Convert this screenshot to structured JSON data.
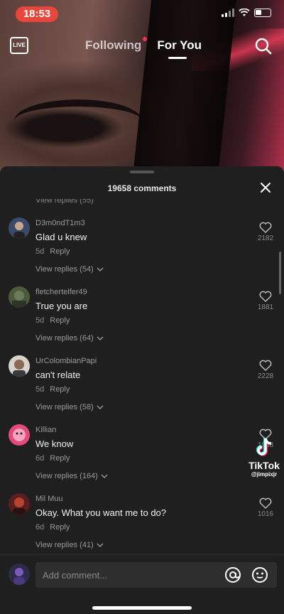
{
  "status_bar": {
    "time": "18:53"
  },
  "nav": {
    "live_label": "LIVE",
    "following_label": "Following",
    "foryou_label": "For You"
  },
  "sheet": {
    "title": "19658 comments",
    "partial_reply": "View replies (55)"
  },
  "comments": [
    {
      "username": "D3m0ndT1m3",
      "text": "Glad u knew",
      "age": "5d",
      "reply_label": "Reply",
      "replies": "View replies (54)",
      "likes": "2182"
    },
    {
      "username": "fletchertelfer49",
      "text": "True you are",
      "age": "5d",
      "reply_label": "Reply",
      "replies": "View replies (64)",
      "likes": "1881"
    },
    {
      "username": "UrColombianPapi",
      "text": "can't relate",
      "age": "5d",
      "reply_label": "Reply",
      "replies": "View replies (58)",
      "likes": "2228"
    },
    {
      "username": "Killian",
      "text": "We know",
      "age": "6d",
      "reply_label": "Reply",
      "replies": "View replies (164)",
      "likes": "1938"
    },
    {
      "username": "Mil Muu",
      "text": "Okay. What you want me to do?",
      "age": "6d",
      "reply_label": "Reply",
      "replies": "View replies (41)",
      "likes": "1016"
    }
  ],
  "watermark": {
    "brand": "TikTok",
    "handle": "@jimpixjr"
  },
  "input": {
    "placeholder": "Add comment..."
  },
  "colors": {
    "accent": "#fe2c55",
    "time_pill": "#e8453c",
    "sheet_bg": "#1f1f1f"
  }
}
